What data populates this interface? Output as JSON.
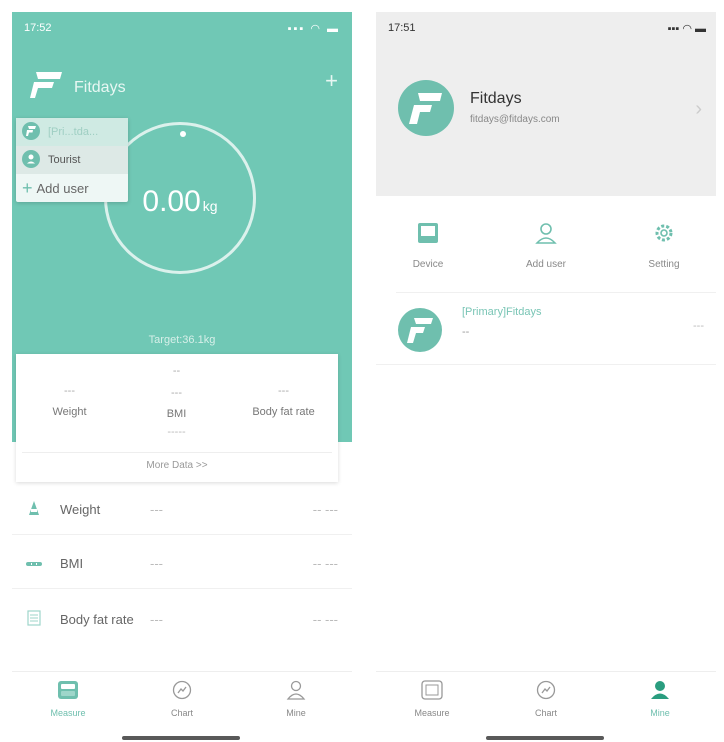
{
  "left": {
    "status": {
      "time": "17:52",
      "icons": "▪▪▪ ◠ ▬"
    },
    "app_name": "Fitdays",
    "add_symbol": "+",
    "user_menu": {
      "primary_label": "[Pri...tda...",
      "tourist_label": "Tourist",
      "add_user_label": "Add user"
    },
    "dial": {
      "value": "0.00",
      "unit": "kg",
      "target": "Target:36.1kg"
    },
    "card": {
      "weight": {
        "value": "---",
        "label": "Weight"
      },
      "bmi": {
        "value_top": "--",
        "value": "---",
        "label": "BMI",
        "sub": "-----"
      },
      "body_fat": {
        "value": "---",
        "label": "Body fat rate"
      },
      "more": "More Data >>"
    },
    "metrics": [
      {
        "label": "Weight",
        "value": "---",
        "right": "-- ---"
      },
      {
        "label": "BMI",
        "value": "---",
        "right": "-- ---"
      },
      {
        "label": "Body fat rate",
        "value": "---",
        "right": "-- ---"
      }
    ],
    "tabs": {
      "measure": "Measure",
      "chart": "Chart",
      "mine": "Mine"
    },
    "accent": "#70c8b5"
  },
  "right": {
    "status": {
      "time": "17:51",
      "icons": "▪▪▪ ◠ ▬"
    },
    "profile": {
      "name": "Fitdays",
      "email": "fitdays@fitdays.com",
      "arrow": "›"
    },
    "actions": {
      "device": "Device",
      "add_user": "Add user",
      "setting": "Setting"
    },
    "user_row": {
      "name": "[Primary]Fitdays",
      "sub": "--",
      "right": "---"
    },
    "tabs": {
      "measure": "Measure",
      "chart": "Chart",
      "mine": "Mine"
    }
  }
}
